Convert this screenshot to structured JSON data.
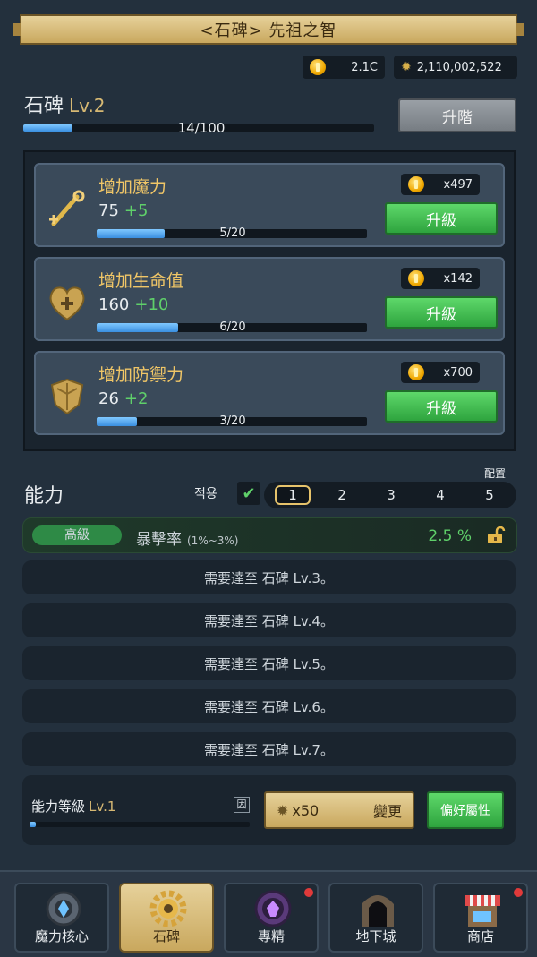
{
  "title": "<石碑> 先祖之智",
  "currencies": {
    "gold": "2.1C",
    "gear": "2,110,002,522"
  },
  "tablet": {
    "name": "石碑",
    "level": "Lv.2",
    "progress_text": "14/100",
    "progress": 0.14
  },
  "advance_button": "升階",
  "stats": [
    {
      "name": "增加魔力",
      "value": "75",
      "increment": "+5",
      "progress_text": "5/20",
      "progress": 0.25,
      "cost": "x497",
      "button": "升級",
      "icon": "wand-icon"
    },
    {
      "name": "增加生命值",
      "value": "160",
      "increment": "+10",
      "progress_text": "6/20",
      "progress": 0.3,
      "cost": "x142",
      "button": "升級",
      "icon": "heart-icon"
    },
    {
      "name": "增加防禦力",
      "value": "26",
      "increment": "+2",
      "progress_text": "3/20",
      "progress": 0.15,
      "cost": "x700",
      "button": "升級",
      "icon": "shield-icon"
    }
  ],
  "ability": {
    "title": "能力",
    "apply_label": "적용",
    "config_label": "配置",
    "presets": [
      "1",
      "2",
      "3",
      "4",
      "5"
    ],
    "active_preset": "1",
    "unlocked": {
      "grade": "高級",
      "name": "暴擊率",
      "range": "(1%~3%)",
      "value": "2.5 %"
    },
    "locked_rows": [
      "需要達至 石碑 Lv.3。",
      "需要達至 石碑 Lv.4。",
      "需要達至 石碑 Lv.5。",
      "需要達至 石碑 Lv.6。",
      "需要達至 石碑 Lv.7。"
    ],
    "level_label": "能力等級",
    "level": "Lv.1",
    "level_progress": 0.02,
    "info_icon": "因",
    "change_cost": "x50",
    "change_label": "變更",
    "preference_label": "偏好屬性"
  },
  "nav": [
    {
      "label": "魔力核心",
      "icon": "magic-core-icon",
      "badge": false
    },
    {
      "label": "石碑",
      "icon": "gear-icon",
      "badge": false
    },
    {
      "label": "專精",
      "icon": "mastery-icon",
      "badge": true
    },
    {
      "label": "地下城",
      "icon": "dungeon-icon",
      "badge": false
    },
    {
      "label": "商店",
      "icon": "shop-icon",
      "badge": true
    }
  ],
  "colors": {
    "gold": "#d6b873",
    "green": "#5fd06a",
    "bar_blue": "#3a8fe0",
    "badge_red": "#e03a3a"
  }
}
